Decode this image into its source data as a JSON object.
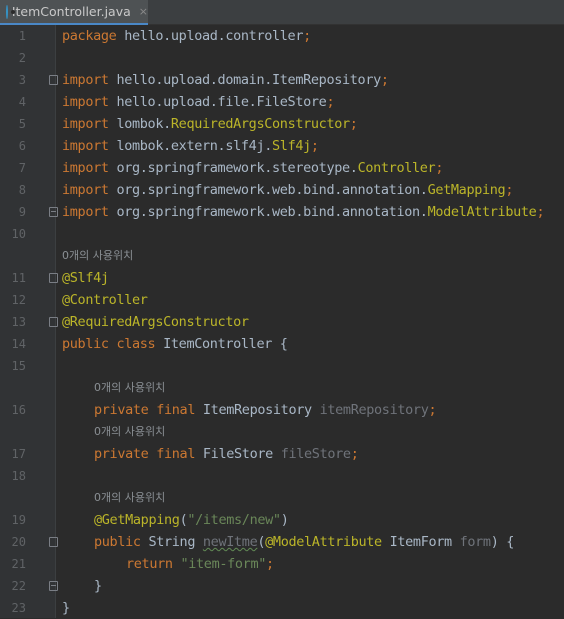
{
  "tab": {
    "icon": "java-class-icon",
    "label": "ItemController.java",
    "close": "×"
  },
  "hint_text": "0개의 사용위치",
  "lines": {
    "l1": {
      "num": "1",
      "kw": "package",
      "rest": " hello.upload.controller",
      "semi": ";"
    },
    "l2": {
      "num": "2"
    },
    "l3": {
      "num": "3",
      "kw": "import",
      "rest": " hello.upload.domain.ItemRepository",
      "semi": ";"
    },
    "l4": {
      "num": "4",
      "kw": "import",
      "rest": " hello.upload.file.FileStore",
      "semi": ";"
    },
    "l5": {
      "num": "5",
      "kw": "import",
      "rest": " lombok.",
      "ann": "RequiredArgsConstructor",
      "semi": ";"
    },
    "l6": {
      "num": "6",
      "kw": "import",
      "rest": " lombok.extern.slf4j.",
      "ann": "Slf4j",
      "semi": ";"
    },
    "l7": {
      "num": "7",
      "kw": "import",
      "rest": " org.springframework.stereotype.",
      "ann": "Controller",
      "semi": ";"
    },
    "l8": {
      "num": "8",
      "kw": "import",
      "rest": " org.springframework.web.bind.annotation.",
      "ann": "GetMapping",
      "semi": ";"
    },
    "l9": {
      "num": "9",
      "kw": "import",
      "rest": " org.springframework.web.bind.annotation.",
      "ann": "ModelAttribute",
      "semi": ";"
    },
    "l10": {
      "num": "10"
    },
    "l11": {
      "num": "11",
      "ann": "@Slf4j"
    },
    "l12": {
      "num": "12",
      "ann": "@Controller"
    },
    "l13": {
      "num": "13",
      "ann": "@RequiredArgsConstructor"
    },
    "l14": {
      "num": "14",
      "kw": "public class",
      "rest": " ItemController {"
    },
    "l15": {
      "num": "15"
    },
    "l16": {
      "num": "16",
      "kw": "private final",
      "type": " ItemRepository ",
      "field": "itemRepository",
      "semi": ";"
    },
    "l17": {
      "num": "17",
      "kw": "private final",
      "type": " FileStore ",
      "field": "fileStore",
      "semi": ";"
    },
    "l18": {
      "num": "18"
    },
    "l19": {
      "num": "19",
      "ann": "@GetMapping",
      "open": "(",
      "str": "\"/items/new\"",
      "close": ")"
    },
    "l20": {
      "num": "20",
      "kw": "public",
      "type": " String ",
      "method": "newItme",
      "open": "(",
      "ann": "@ModelAttribute",
      "type2": " ItemForm ",
      "param": "form",
      "close": ") {"
    },
    "l21": {
      "num": "21",
      "kw": "return",
      "str": "\"item-form\"",
      "semi": ";"
    },
    "l22": {
      "num": "22",
      "rest": "}"
    },
    "l23": {
      "num": "23",
      "rest": "}"
    }
  }
}
